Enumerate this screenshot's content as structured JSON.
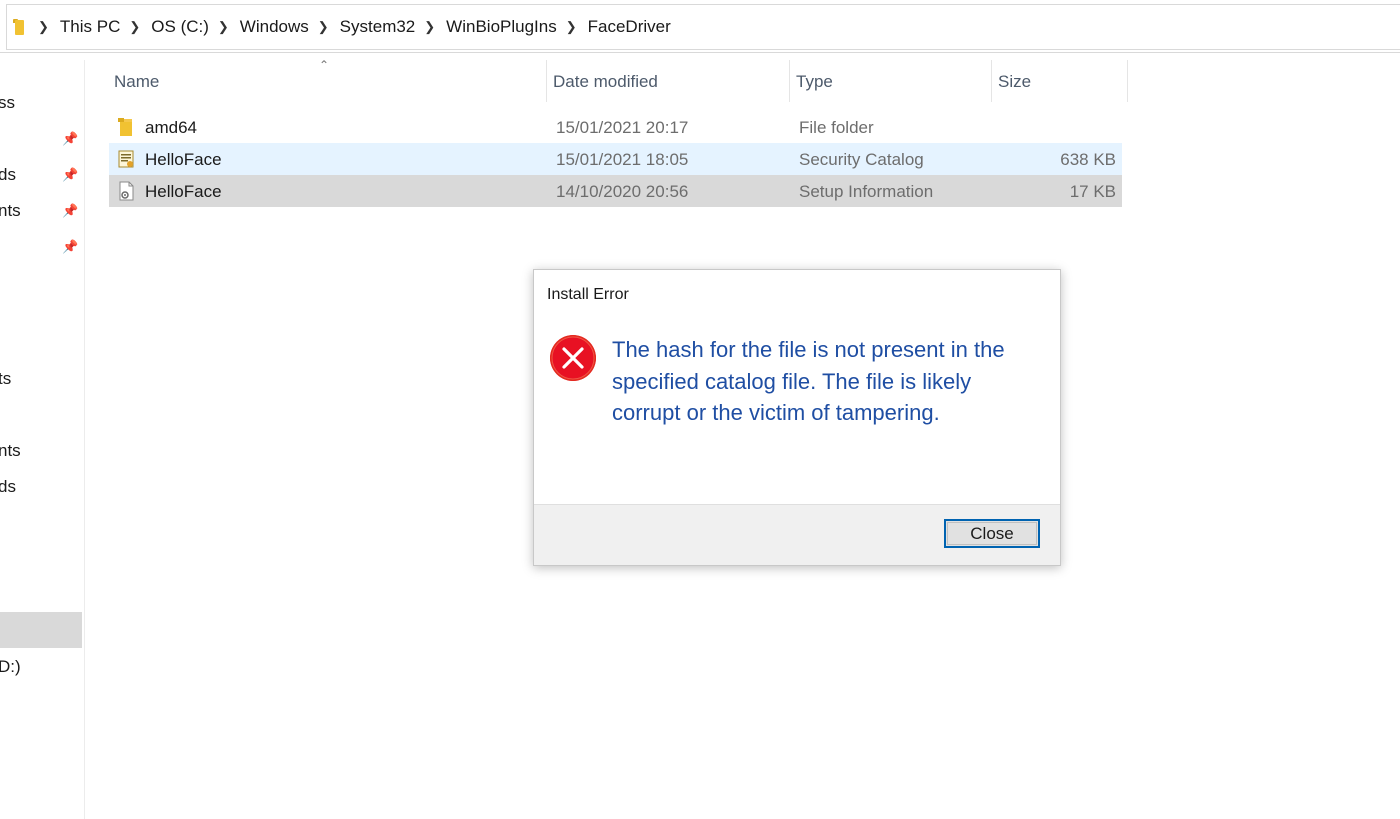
{
  "breadcrumb": [
    "This PC",
    "OS (C:)",
    "Windows",
    "System32",
    "WinBioPlugIns",
    "FaceDriver"
  ],
  "nav_fragments": [
    "ss",
    "ds",
    "nts",
    "",
    "ts",
    "nts",
    "ds",
    "D:)"
  ],
  "columns": {
    "name": "Name",
    "date": "Date modified",
    "type": "Type",
    "size": "Size"
  },
  "files": [
    {
      "name": "amd64",
      "date": "15/01/2021 20:17",
      "type": "File folder",
      "size": "",
      "icon": "folder-icon"
    },
    {
      "name": "HelloFace",
      "date": "15/01/2021 18:05",
      "type": "Security Catalog",
      "size": "638 KB",
      "icon": "catalog-file-icon"
    },
    {
      "name": "HelloFace",
      "date": "14/10/2020 20:56",
      "type": "Setup Information",
      "size": "17 KB",
      "icon": "setup-info-file-icon"
    }
  ],
  "dialog": {
    "title": "Install Error",
    "message": "The hash for the file is not present in the specified catalog file. The file is likely corrupt or the victim of tampering.",
    "close_label": "Close",
    "icon": "error-icon"
  },
  "colors": {
    "message_text": "#1f4ea3",
    "error_icon": "#e81123",
    "row_hover": "#e5f3ff",
    "row_selected": "#d9d9d9",
    "button_border": "#0063b1"
  }
}
